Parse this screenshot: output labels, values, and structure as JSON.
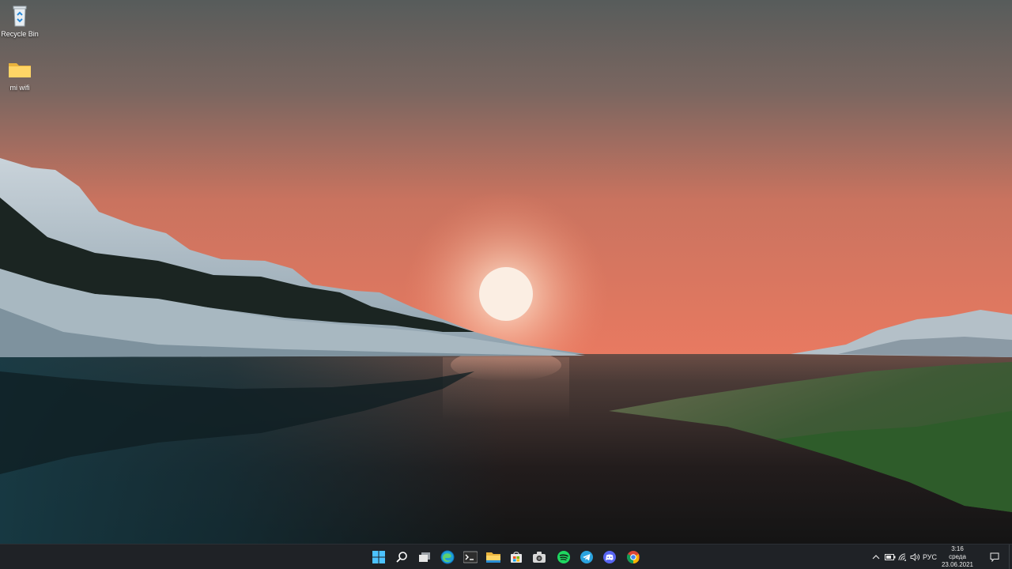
{
  "desktop": {
    "icons": [
      {
        "label": "Recycle Bin",
        "icon": "recycle-bin-icon"
      },
      {
        "label": "mi wifi",
        "icon": "folder-icon"
      }
    ]
  },
  "taskbar": {
    "apps": [
      {
        "name": "Start",
        "icon": "windows-start-icon"
      },
      {
        "name": "Search",
        "icon": "search-icon"
      },
      {
        "name": "Task View",
        "icon": "task-view-icon"
      },
      {
        "name": "Microsoft Edge",
        "icon": "edge-icon"
      },
      {
        "name": "Terminal",
        "icon": "terminal-icon"
      },
      {
        "name": "File Explorer",
        "icon": "file-explorer-icon"
      },
      {
        "name": "Microsoft Store",
        "icon": "store-icon"
      },
      {
        "name": "Camera",
        "icon": "camera-icon"
      },
      {
        "name": "Spotify",
        "icon": "spotify-icon"
      },
      {
        "name": "Telegram",
        "icon": "telegram-icon"
      },
      {
        "name": "Discord",
        "icon": "discord-icon"
      },
      {
        "name": "Google Chrome",
        "icon": "chrome-icon"
      }
    ],
    "tray": {
      "language": "РУС",
      "time": "3:16",
      "day": "среда",
      "date": "23.06.2021"
    }
  },
  "colors": {
    "taskbar_bg": "#1f2226",
    "accent_blue": "#4cc2ff",
    "sky_top": "#595e5c",
    "sky_horizon": "#e57a62"
  }
}
